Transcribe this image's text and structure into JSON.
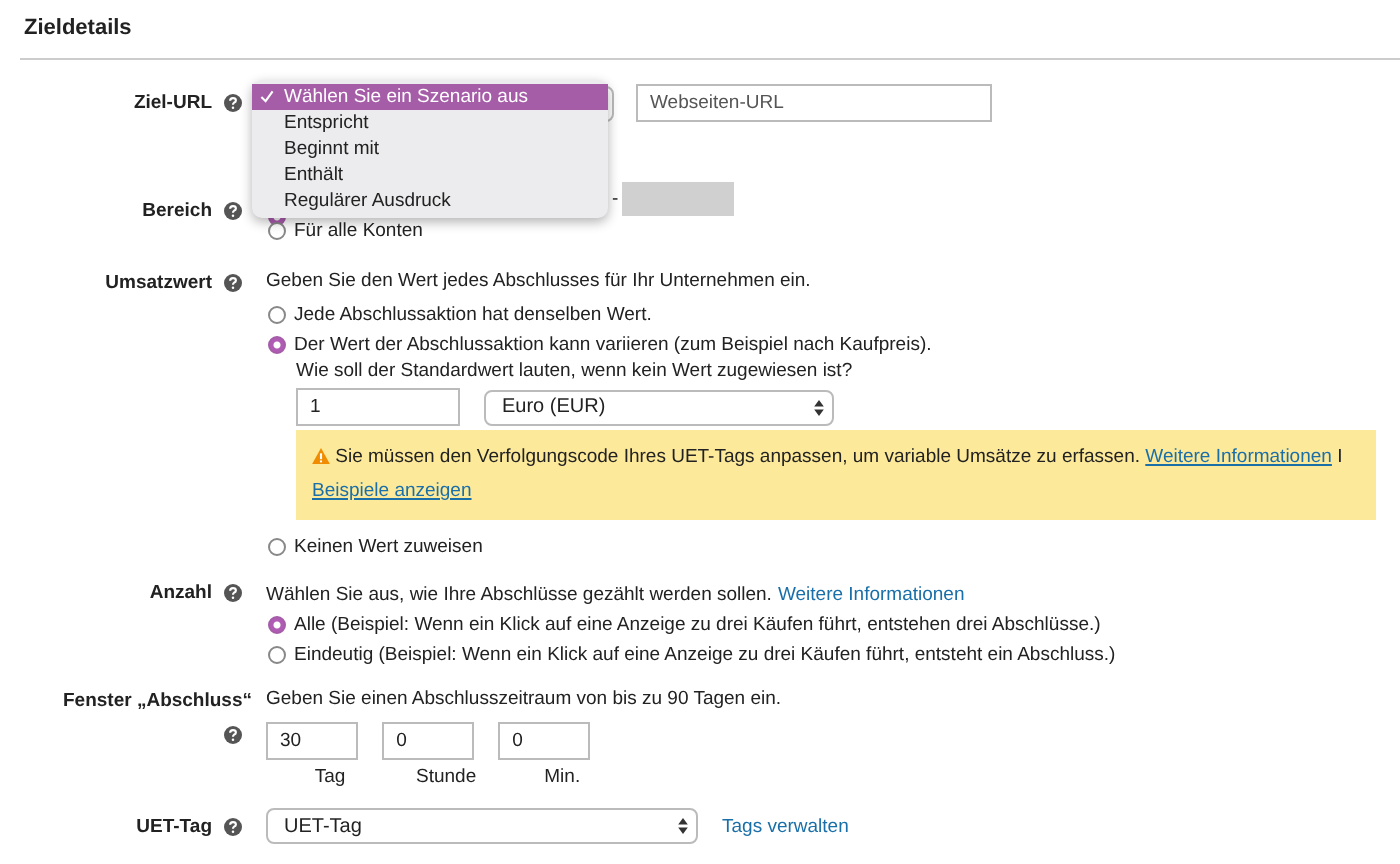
{
  "section_title": "Zieldetails",
  "ziel_url": {
    "label": "Ziel-URL",
    "menu": [
      {
        "label": "Wählen Sie ein Szenario aus",
        "selected": true
      },
      {
        "label": "Entspricht",
        "selected": false
      },
      {
        "label": "Beginnt mit",
        "selected": false
      },
      {
        "label": "Enthält",
        "selected": false
      },
      {
        "label": "Regulärer Ausdruck",
        "selected": false
      }
    ],
    "url_field": {
      "placeholder": "Webseiten-URL"
    }
  },
  "bereich": {
    "label": "Bereich",
    "suffix": "-",
    "options": [
      {
        "selected": true
      },
      {
        "label": "Für alle Konten",
        "selected": false
      }
    ]
  },
  "umsatzwert": {
    "label": "Umsatzwert",
    "description": "Geben Sie den Wert jedes Abschlusses für Ihr Unternehmen ein.",
    "options": [
      {
        "label": "Jede Abschlussaktion hat denselben Wert.",
        "selected": false
      },
      {
        "label": "Der Wert der Abschlussaktion kann variieren (zum Beispiel nach Kaufpreis).",
        "selected": true
      },
      {
        "label": "Keinen Wert zuweisen",
        "selected": false
      }
    ],
    "default_prompt": "Wie soll der Standardwert lauten, wenn kein Wert zugewiesen ist?",
    "value_field": {
      "value": "1"
    },
    "currency_select": {
      "value": "Euro (EUR)"
    },
    "warning": {
      "text": "Sie müssen den Verfolgungscode Ihres UET-Tags anpassen, um variable Umsätze zu erfassen.",
      "link_1": "Weitere Informationen",
      "separator": "I",
      "link_2": "Beispiele anzeigen"
    }
  },
  "anzahl": {
    "label": "Anzahl",
    "description": "Wählen Sie aus, wie Ihre Abschlüsse gezählt werden sollen.",
    "link": "Weitere Informationen",
    "options": [
      {
        "label": "Alle (Beispiel: Wenn ein Klick auf eine Anzeige zu drei Käufen führt, entstehen drei Abschlüsse.)",
        "selected": true
      },
      {
        "label": "Eindeutig (Beispiel: Wenn ein Klick auf eine Anzeige zu drei Käufen führt, entsteht ein Abschluss.)",
        "selected": false
      }
    ]
  },
  "fenster": {
    "label": "Fenster „Abschluss“",
    "description": "Geben Sie einen Abschlusszeitraum von bis zu 90 Tagen ein.",
    "fields": [
      {
        "value": "30",
        "unit": "Tag"
      },
      {
        "value": "0",
        "unit": "Stunde"
      },
      {
        "value": "0",
        "unit": "Min."
      }
    ]
  },
  "uet_tag": {
    "label": "UET-Tag",
    "select": {
      "value": "UET-Tag"
    },
    "link": "Tags verwalten"
  }
}
